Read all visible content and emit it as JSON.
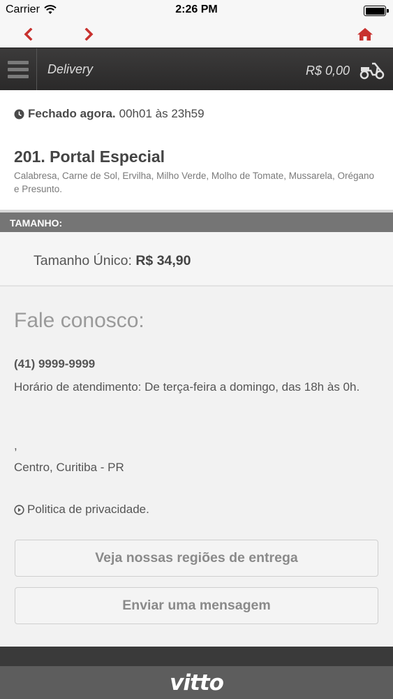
{
  "status_bar": {
    "carrier": "Carrier",
    "time": "2:26 PM"
  },
  "header": {
    "title": "Delivery",
    "cart_total": "R$ 0,00"
  },
  "store": {
    "status_label": "Fechado agora.",
    "hours": "00h01 às 23h59"
  },
  "product": {
    "title": "201. Portal Especial",
    "description": "Calabresa, Carne de Sol, Ervilha, Milho Verde, Molho de Tomate, Mussarela, Orégano e Presunto."
  },
  "size_section": {
    "header": "TAMANHO:",
    "option_label": "Tamanho Único:",
    "option_price": "R$ 34,90"
  },
  "contact": {
    "heading": "Fale conosco:",
    "phone": "(41) 9999-9999",
    "attendance": "Horário de atendimento: De terça-feira a domingo, das 18h às 0h.",
    "address_line1": ",",
    "address_line2": "Centro, Curitiba - PR",
    "privacy_label": "Politica de privacidade."
  },
  "buttons": {
    "regions": "Veja nossas regiões de entrega",
    "message": "Enviar uma mensagem"
  },
  "footer": {
    "logo": "vitto"
  },
  "colors": {
    "accent_red": "#c8322f",
    "header_bg": "#2e2d2d",
    "section_header_bg": "#757575"
  },
  "icons": {
    "back": "chevron-left-icon",
    "forward": "chevron-right-icon",
    "home": "home-icon",
    "menu": "hamburger-menu-icon",
    "delivery": "scooter-icon",
    "clock": "clock-icon",
    "privacy": "circle-play-icon",
    "wifi": "wifi-icon",
    "battery": "battery-icon"
  }
}
